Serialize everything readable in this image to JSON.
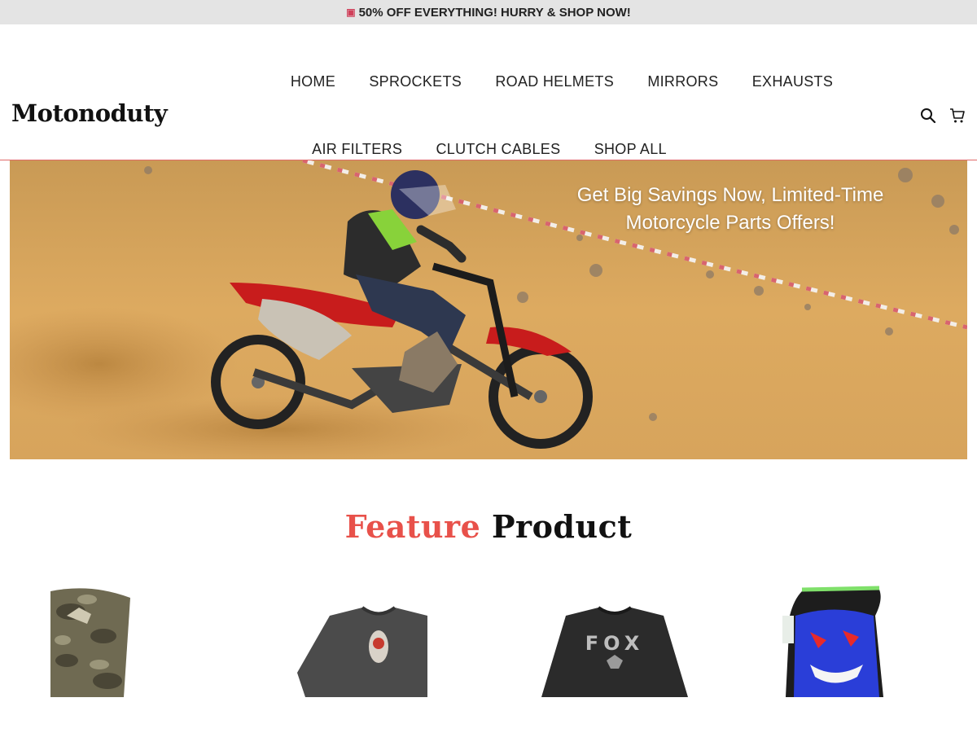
{
  "announcement": {
    "text": "50% OFF EVERYTHING! HURRY & SHOP NOW!",
    "icon": "truck-icon"
  },
  "header": {
    "logo": "Motonoduty"
  },
  "nav": {
    "row1": [
      "HOME",
      "SPROCKETS",
      "ROAD HELMETS",
      "MIRRORS",
      "EXHAUSTS"
    ],
    "row2": [
      "AIR FILTERS",
      "CLUTCH CABLES",
      "SHOP ALL"
    ]
  },
  "header_icons": [
    "search-icon",
    "cart-icon"
  ],
  "hero": {
    "headline": "Get Big Savings Now, Limited-Time Motorcycle Parts Offers!"
  },
  "feature": {
    "accent": "Feature",
    "rest": "Product"
  },
  "products": [
    {
      "image": "camo-fox-sock"
    },
    {
      "image": "grey-graphic-tshirt"
    },
    {
      "image": "black-fox-tshirt"
    },
    {
      "image": "blue-red-print-glove"
    }
  ],
  "colors": {
    "accent": "#e8514a",
    "announce_bg": "#e4e4e4",
    "sand": "#d9a55a"
  }
}
